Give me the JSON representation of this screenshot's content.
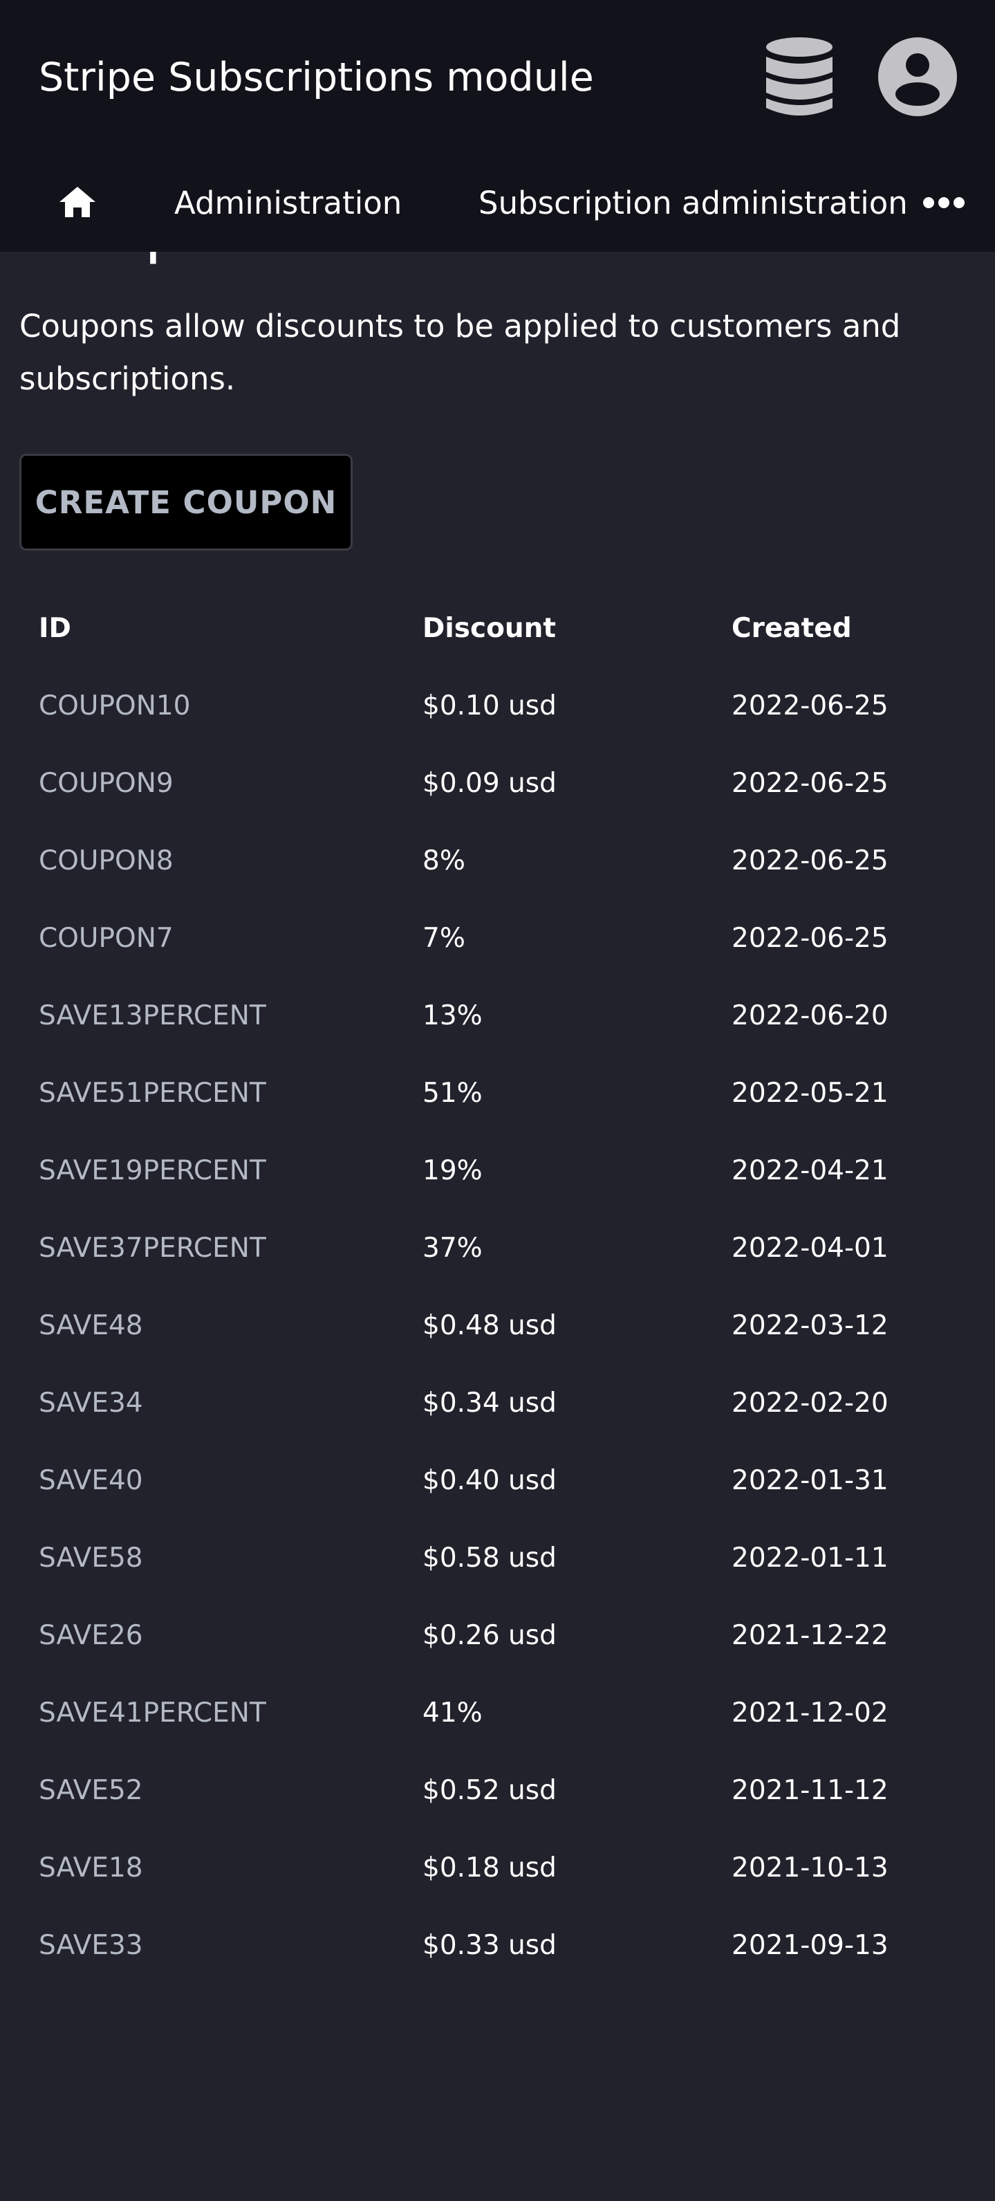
{
  "header": {
    "title": "Stripe Subscriptions module",
    "icons": {
      "database": "database-icon",
      "user": "user-account-icon"
    }
  },
  "nav": {
    "home_icon": "home-icon",
    "items": [
      {
        "label": "Administration"
      },
      {
        "label": "Subscription administration"
      }
    ],
    "more_icon": "more-horizontal-icon"
  },
  "page": {
    "title": "Coupons",
    "description": "Coupons allow discounts to be applied to customers and subscriptions.",
    "create_button_label": "CREATE COUPON"
  },
  "table": {
    "columns": [
      "ID",
      "Discount",
      "Created"
    ],
    "rows": [
      {
        "id": "COUPON10",
        "discount": "$0.10 usd",
        "created": "2022-06-25"
      },
      {
        "id": "COUPON9",
        "discount": "$0.09 usd",
        "created": "2022-06-25"
      },
      {
        "id": "COUPON8",
        "discount": "8%",
        "created": "2022-06-25"
      },
      {
        "id": "COUPON7",
        "discount": "7%",
        "created": "2022-06-25"
      },
      {
        "id": "SAVE13PERCENT",
        "discount": "13%",
        "created": "2022-06-20"
      },
      {
        "id": "SAVE51PERCENT",
        "discount": "51%",
        "created": "2022-05-21"
      },
      {
        "id": "SAVE19PERCENT",
        "discount": "19%",
        "created": "2022-04-21"
      },
      {
        "id": "SAVE37PERCENT",
        "discount": "37%",
        "created": "2022-04-01"
      },
      {
        "id": "SAVE48",
        "discount": "$0.48 usd",
        "created": "2022-03-12"
      },
      {
        "id": "SAVE34",
        "discount": "$0.34 usd",
        "created": "2022-02-20"
      },
      {
        "id": "SAVE40",
        "discount": "$0.40 usd",
        "created": "2022-01-31"
      },
      {
        "id": "SAVE58",
        "discount": "$0.58 usd",
        "created": "2022-01-11"
      },
      {
        "id": "SAVE26",
        "discount": "$0.26 usd",
        "created": "2021-12-22"
      },
      {
        "id": "SAVE41PERCENT",
        "discount": "41%",
        "created": "2021-12-02"
      },
      {
        "id": "SAVE52",
        "discount": "$0.52 usd",
        "created": "2021-11-12"
      },
      {
        "id": "SAVE18",
        "discount": "$0.18 usd",
        "created": "2021-10-13"
      },
      {
        "id": "SAVE33",
        "discount": "$0.33 usd",
        "created": "2021-09-13"
      }
    ]
  },
  "colors": {
    "background": "#21222b",
    "header_background": "#12121a",
    "icon_gray": "#c2c2c6",
    "link_text": "#b3b9c5",
    "button_background": "#000000"
  }
}
